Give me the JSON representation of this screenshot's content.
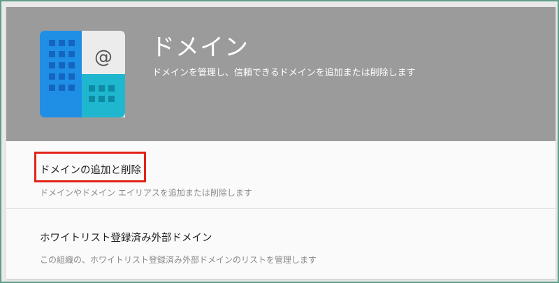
{
  "header": {
    "title": "ドメイン",
    "description": "ドメインを管理し、信頼できるドメインを追加または削除します",
    "icon": "domain-building-at-icon",
    "background_color": "#9b9b9b"
  },
  "items": [
    {
      "title": "ドメインの追加と削除",
      "description": "ドメインやドメイン エイリアスを追加または削除します",
      "highlighted": true,
      "highlight_color": "#e2231a"
    },
    {
      "title": "ホワイトリスト登録済み外部ドメイン",
      "description": "この組織の、ホワイトリスト登録済み外部ドメインのリストを管理します",
      "highlighted": false
    }
  ]
}
